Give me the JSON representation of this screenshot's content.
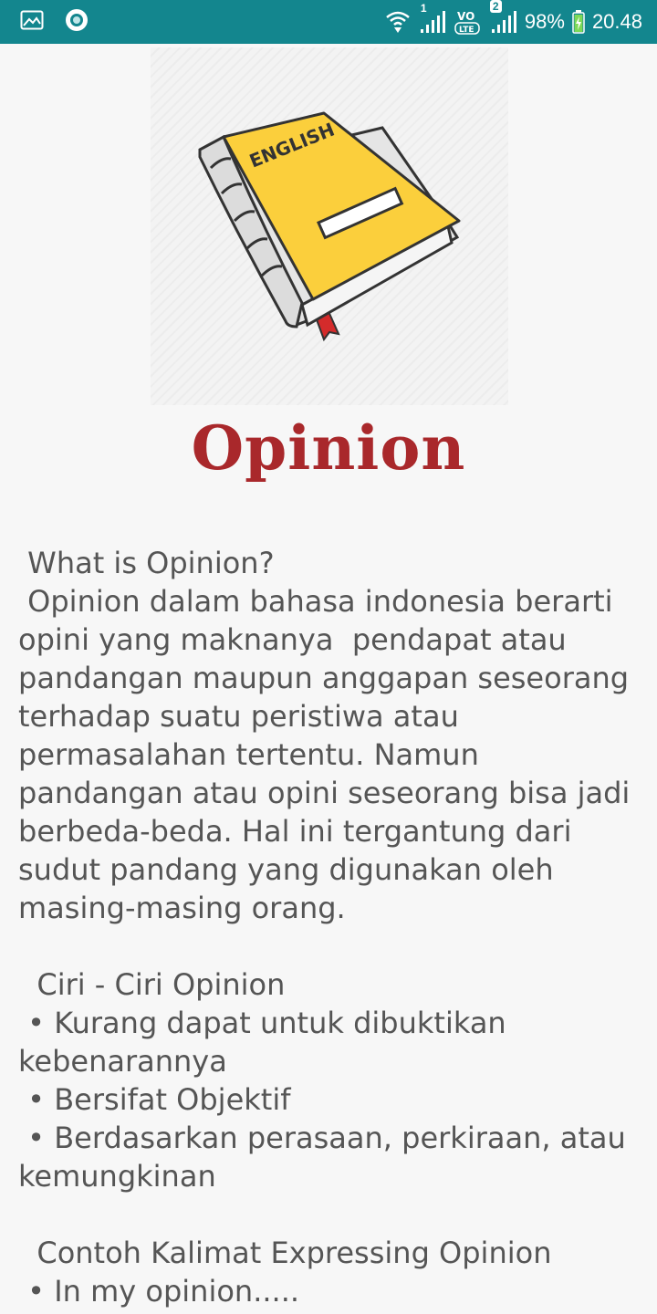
{
  "status_bar": {
    "sim1_label": "1",
    "volte_label": "VO LTE",
    "sim2_label": "2",
    "battery": "98%",
    "time": "20.48"
  },
  "book": {
    "cover_text": "ENGLISH"
  },
  "title": "Opinion",
  "content": {
    "heading": " What is Opinion?",
    "paragraph": " Opinion dalam bahasa indonesia berarti opini yang maknanya  pendapat atau pandangan maupun anggapan seseorang terhadap suatu peristiwa atau permasalahan tertentu. Namun pandangan atau opini seseorang bisa jadi berbeda-beda. Hal ini tergantung dari sudut pandang yang digunakan oleh masing-masing orang.",
    "ciri_heading": "  Ciri - Ciri Opinion",
    "ciri_items": [
      " • Kurang dapat untuk dibuktikan kebenarannya",
      " • Bersifat Objektif",
      " • Berdasarkan perasaan, perkiraan, atau kemungkinan"
    ],
    "contoh_heading": "  Contoh Kalimat Expressing Opinion",
    "contoh_items": [
      " • In my opinion....."
    ]
  }
}
